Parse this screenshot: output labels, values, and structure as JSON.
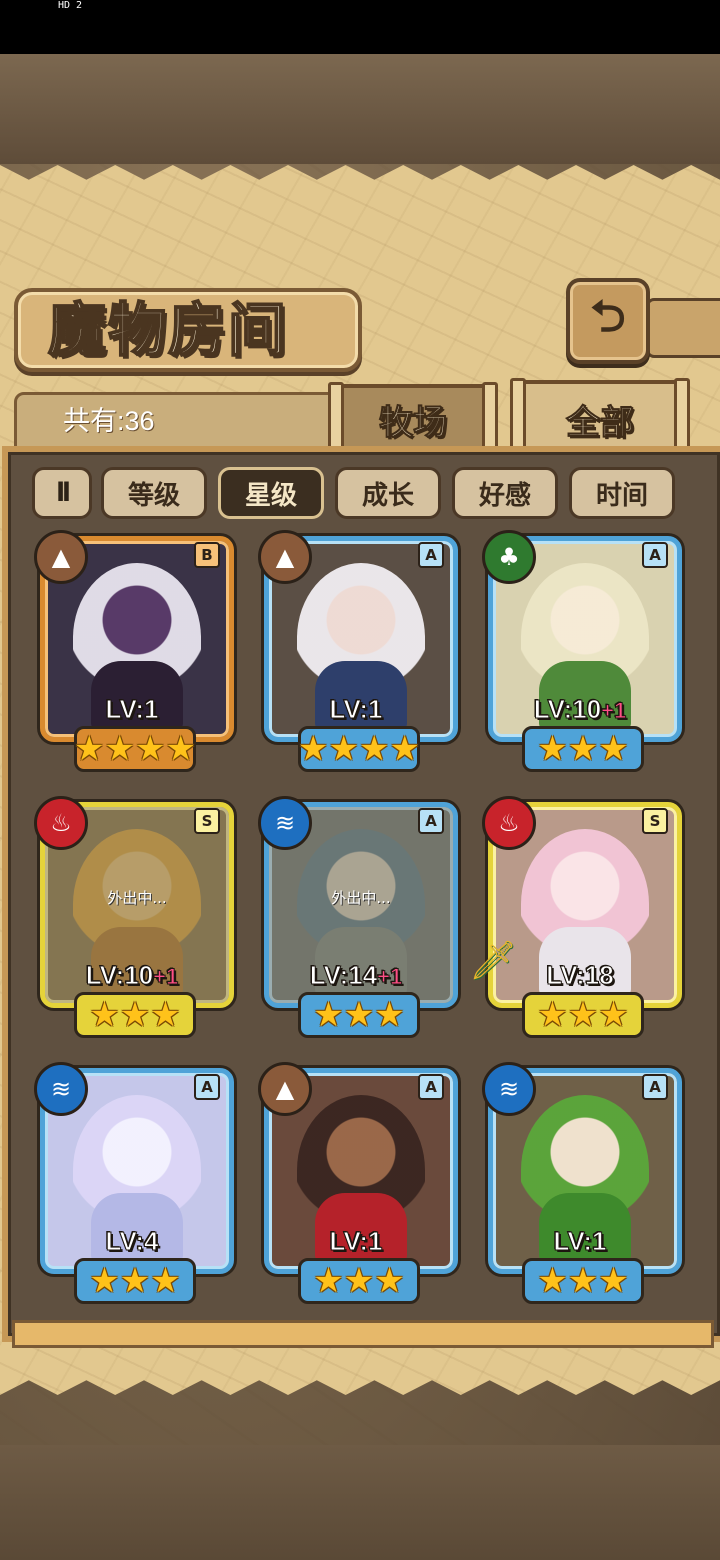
{
  "status_bar": {
    "left_text": "HD 2"
  },
  "header": {
    "title": "魔物房间",
    "back_icon": "return-arrow-icon"
  },
  "summary": {
    "count_label": "共有:36"
  },
  "tabs": [
    {
      "label": "牧场",
      "active": false
    },
    {
      "label": "全部",
      "active": true
    }
  ],
  "sort_toggle": {
    "icon": "ll",
    "icon_name": "sort-order-icon"
  },
  "filters": [
    {
      "label": "等级",
      "active": false
    },
    {
      "label": "星级",
      "active": true
    },
    {
      "label": "成长",
      "active": false
    },
    {
      "label": "好感",
      "active": false
    },
    {
      "label": "时间",
      "active": false
    }
  ],
  "monsters": [
    {
      "element": "earth",
      "element_glyph": "▲",
      "rank": "B",
      "frame": "orange",
      "level": "LV:1",
      "bonus": "",
      "stars": 4,
      "star_text": "★★★★",
      "away": false,
      "away_text": "",
      "equip": false,
      "colors": {
        "portrait": "#3a3347",
        "hair": "#e8e4ee",
        "skin": "#5a3a6a",
        "outfit": "#2b1f33"
      }
    },
    {
      "element": "earth",
      "element_glyph": "▲",
      "rank": "A",
      "frame": "blue",
      "level": "LV:1",
      "bonus": "",
      "stars": 4,
      "star_text": "★★★★",
      "away": false,
      "away_text": "",
      "equip": false,
      "colors": {
        "portrait": "#5b4f45",
        "hair": "#f2eef2",
        "skin": "#f6e2dc",
        "outfit": "#2e3f6b"
      }
    },
    {
      "element": "wood",
      "element_glyph": "♣",
      "rank": "A",
      "frame": "blue",
      "level": "LV:10",
      "bonus": "+1",
      "stars": 3,
      "star_text": "★★★",
      "away": false,
      "away_text": "",
      "equip": false,
      "colors": {
        "portrait": "#d9d2b0",
        "hair": "#ece6c6",
        "skin": "#f7ecd8",
        "outfit": "#4f8a3a"
      }
    },
    {
      "element": "fire",
      "element_glyph": "♨",
      "rank": "S",
      "frame": "yellow",
      "level": "LV:10",
      "bonus": "+1",
      "stars": 3,
      "star_text": "★★★",
      "away": true,
      "away_text": "外出中...",
      "equip": false,
      "colors": {
        "portrait": "#8f7a4a",
        "hair": "#e2a93a",
        "skin": "#f0c878",
        "outfit": "#b57a2a"
      }
    },
    {
      "element": "water",
      "element_glyph": "≋",
      "rank": "A",
      "frame": "blue",
      "level": "LV:14",
      "bonus": "+1",
      "stars": 3,
      "star_text": "★★★",
      "away": true,
      "away_text": "外出中...",
      "equip": false,
      "colors": {
        "portrait": "#6f7a78",
        "hair": "#5d7f8e",
        "skin": "#d8d3c4",
        "outfit": "#7d8a86"
      }
    },
    {
      "element": "fire",
      "element_glyph": "♨",
      "rank": "S",
      "frame": "yellow",
      "level": "LV:18",
      "bonus": "",
      "stars": 3,
      "star_text": "★★★",
      "away": false,
      "away_text": "",
      "equip": true,
      "colors": {
        "portrait": "#b99a8a",
        "hair": "#f4c6d8",
        "skin": "#fde8ec",
        "outfit": "#e9e4ea"
      }
    },
    {
      "element": "water",
      "element_glyph": "≋",
      "rank": "A",
      "frame": "blue",
      "level": "LV:4",
      "bonus": "",
      "stars": 3,
      "star_text": "★★★",
      "away": false,
      "away_text": "",
      "equip": false,
      "colors": {
        "portrait": "#c5c7ea",
        "hair": "#dcd6f7",
        "skin": "#f5f3ff",
        "outfit": "#b4b8e6"
      }
    },
    {
      "element": "earth",
      "element_glyph": "▲",
      "rank": "A",
      "frame": "blue",
      "level": "LV:1",
      "bonus": "",
      "stars": 3,
      "star_text": "★★★",
      "away": false,
      "away_text": "",
      "equip": false,
      "colors": {
        "portrait": "#6a4a3c",
        "hair": "#3a2520",
        "skin": "#9c6a4a",
        "outfit": "#b5222a"
      }
    },
    {
      "element": "water",
      "element_glyph": "≋",
      "rank": "A",
      "frame": "blue",
      "level": "LV:1",
      "bonus": "",
      "stars": 3,
      "star_text": "★★★",
      "away": false,
      "away_text": "",
      "equip": false,
      "colors": {
        "portrait": "#6f6048",
        "hair": "#5aa83a",
        "skin": "#f6e8d4",
        "outfit": "#3e8a2c"
      }
    }
  ]
}
